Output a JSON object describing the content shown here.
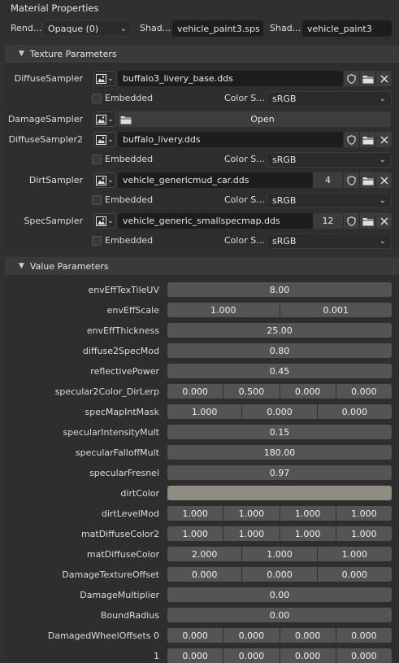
{
  "panel_title": "Material Properties",
  "header": {
    "render_label": "Rend...",
    "render_value": "Opaque (0)",
    "shader_label_1": "Shad...",
    "shader_value_1": "vehicle_paint3.sps",
    "shader_label_2": "Shad...",
    "shader_value_2": "vehicle_paint3"
  },
  "texture_section_title": "Texture Parameters",
  "textures": [
    {
      "label": "DiffuseSampler",
      "file": "buffalo3_livery_base.dds",
      "count": "",
      "embedded_label": "Embedded",
      "colorspace_label": "Color S...",
      "colorspace_value": "sRGB"
    },
    {
      "label": "DamageSampler",
      "open_label": "Open"
    },
    {
      "label": "DiffuseSampler2",
      "file": "buffalo_livery.dds",
      "count": "",
      "embedded_label": "Embedded",
      "colorspace_label": "Color S...",
      "colorspace_value": "sRGB"
    },
    {
      "label": "DirtSampler",
      "file": "vehicle_genericmud_car.dds",
      "count": "4",
      "embedded_label": "Embedded",
      "colorspace_label": "Color S...",
      "colorspace_value": "sRGB"
    },
    {
      "label": "SpecSampler",
      "file": "vehicle_generic_smallspecmap.dds",
      "count": "12",
      "embedded_label": "Embedded",
      "colorspace_label": "Color S...",
      "colorspace_value": "sRGB"
    }
  ],
  "value_section_title": "Value Parameters",
  "values": [
    {
      "label": "envEffTexTileUV",
      "vals": [
        "8.00"
      ]
    },
    {
      "label": "envEffScale",
      "vals": [
        "1.000",
        "0.001"
      ]
    },
    {
      "label": "envEffThickness",
      "vals": [
        "25.00"
      ]
    },
    {
      "label": "diffuse2SpecMod",
      "vals": [
        "0.80"
      ]
    },
    {
      "label": "reflectivePower",
      "vals": [
        "0.45"
      ]
    },
    {
      "label": "specular2Color_DirLerp",
      "vals": [
        "0.000",
        "0.500",
        "0.000",
        "0.000"
      ]
    },
    {
      "label": "specMapIntMask",
      "vals": [
        "1.000",
        "0.000",
        "0.000"
      ]
    },
    {
      "label": "specularIntensityMult",
      "vals": [
        "0.15"
      ]
    },
    {
      "label": "specularFalloffMult",
      "vals": [
        "180.00"
      ]
    },
    {
      "label": "specularFresnel",
      "vals": [
        "0.97"
      ]
    },
    {
      "label": "dirtColor",
      "color": "#8f8d82"
    },
    {
      "label": "dirtLevelMod",
      "vals": [
        "1.000",
        "1.000",
        "1.000",
        "1.000"
      ]
    },
    {
      "label": "matDiffuseColor2",
      "vals": [
        "1.000",
        "1.000",
        "1.000",
        "1.000"
      ]
    },
    {
      "label": "matDiffuseColor",
      "vals": [
        "2.000",
        "1.000",
        "1.000"
      ]
    },
    {
      "label": "DamageTextureOffset",
      "vals": [
        "0.000",
        "0.000",
        "0.000"
      ]
    },
    {
      "label": "DamageMultiplier",
      "vals": [
        "0.00"
      ]
    },
    {
      "label": "BoundRadius",
      "vals": [
        "0.00"
      ]
    },
    {
      "label": "DamagedWheelOffsets 0",
      "vals": [
        "0.000",
        "0.000",
        "0.000",
        "0.000"
      ]
    },
    {
      "label": "1",
      "vals": [
        "0.000",
        "0.000",
        "0.000",
        "0.000"
      ]
    }
  ],
  "icons": {
    "image": "image-icon",
    "shield": "shield-icon",
    "folder": "folder-icon",
    "close": "close-icon",
    "chevron": "chevron-down-icon"
  }
}
